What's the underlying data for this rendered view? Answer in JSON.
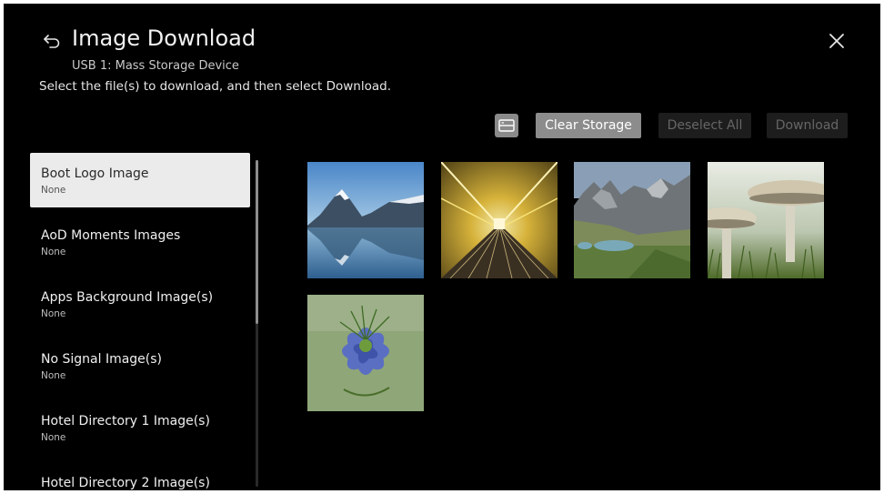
{
  "header": {
    "title": "Image Download",
    "subtitle": "USB 1: Mass Storage Device",
    "instructions": "Select the file(s) to download, and then select Download."
  },
  "toolbar": {
    "view_toggle_icon": "list-view-icon",
    "clear_storage": "Clear Storage",
    "deselect_all": "Deselect All",
    "download": "Download"
  },
  "categories": [
    {
      "label": "Boot Logo Image",
      "value": "None",
      "selected": true
    },
    {
      "label": "AoD Moments Images",
      "value": "None"
    },
    {
      "label": "Apps Background Image(s)",
      "value": "None"
    },
    {
      "label": "No Signal Image(s)",
      "value": "None"
    },
    {
      "label": "Hotel Directory 1 Image(s)",
      "value": "None"
    },
    {
      "label": "Hotel Directory 2 Image(s)"
    }
  ],
  "images": [
    {
      "subject": "mountain-lake"
    },
    {
      "subject": "yellow-tunnel-walkway"
    },
    {
      "subject": "rocky-mountains-lake"
    },
    {
      "subject": "mushrooms"
    },
    {
      "subject": "blue-flower"
    }
  ],
  "colors": {
    "background": "#000000",
    "selected_item": "#ebebeb",
    "primary_button": "#8c8c8c",
    "disabled_button": "#1d1d1d",
    "disabled_text": "#666666"
  }
}
